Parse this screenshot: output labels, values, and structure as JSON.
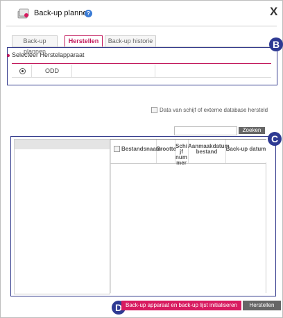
{
  "window": {
    "title": "Back-up plannen",
    "help_icon": "?",
    "close_icon": "X"
  },
  "tabs": [
    {
      "label": "Back-up plannen",
      "active": false
    },
    {
      "label": "Herstellen",
      "active": true
    },
    {
      "label": "Back-up historie",
      "active": false
    }
  ],
  "device_section": {
    "label": "Selecteer Herstelapparaat",
    "rows": [
      {
        "selected": true,
        "name": "ODD"
      }
    ]
  },
  "external_db": {
    "checked": false,
    "label": "Data van schijf of externe database hersteld"
  },
  "search": {
    "value": "",
    "button_label": "Zoeken"
  },
  "file_table": {
    "columns": [
      "Bestandsnaam",
      "Grootte",
      "Schijf nummer",
      "Aanmaakdatum bestand",
      "Back-up datum"
    ],
    "rows": []
  },
  "buttons": {
    "initialize_label": "Back-up apparaat en back-up lijst initialiseren",
    "restore_label": "Herstellen"
  },
  "markers": {
    "b": "B",
    "c": "C",
    "d": "D"
  },
  "colors": {
    "accent": "#d81b60",
    "marker": "#2e3a93",
    "button_gray": "#666666"
  }
}
